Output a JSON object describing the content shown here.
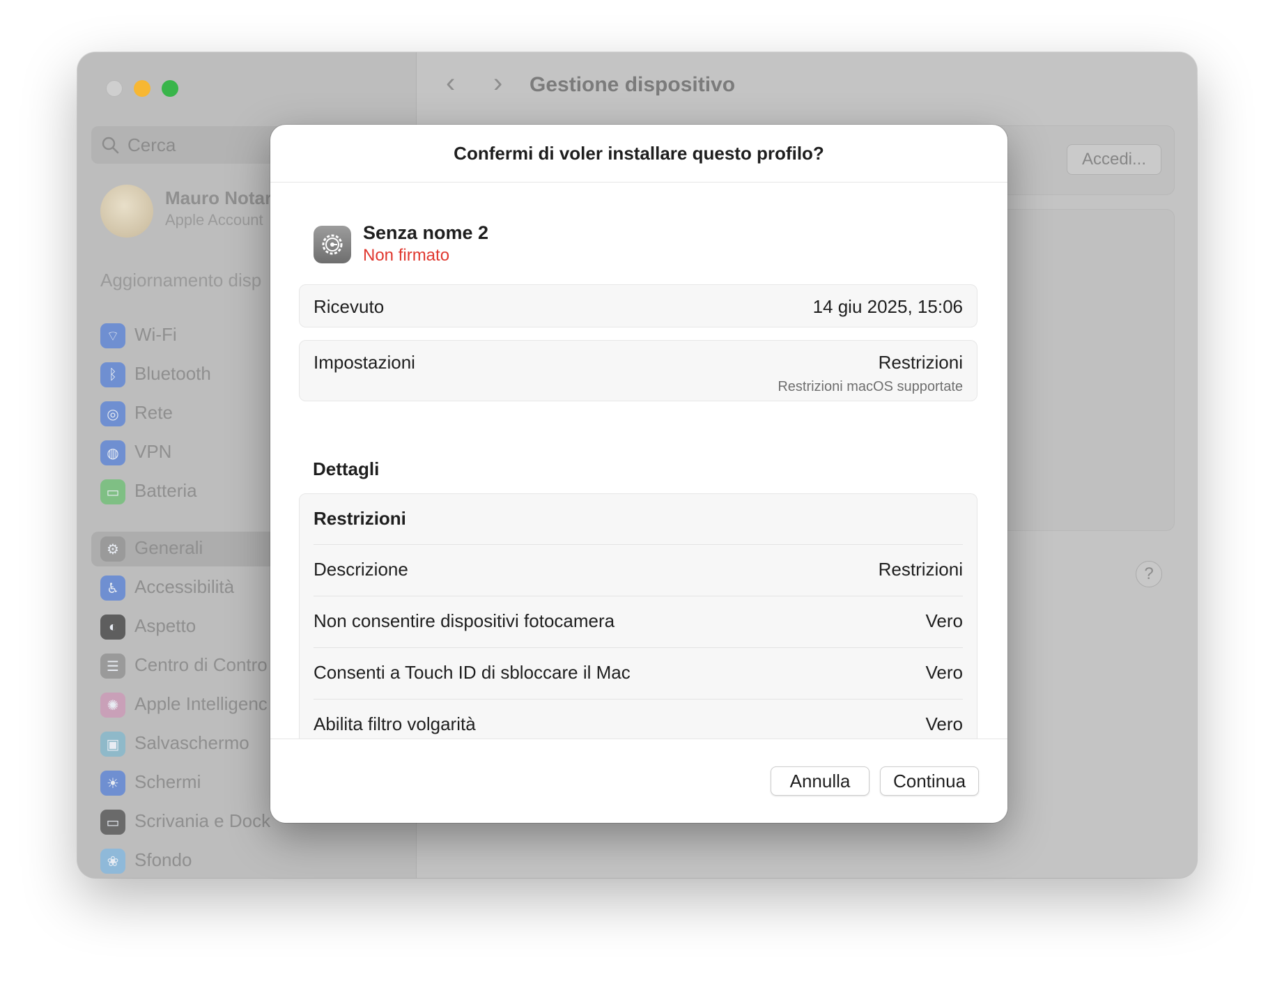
{
  "window": {
    "title": "Gestione dispositivo"
  },
  "sidebar": {
    "search_placeholder": "Cerca",
    "account": {
      "name": "Mauro Notar",
      "subtitle": "Apple Account"
    },
    "update_label": "Aggiornamento disp",
    "items": [
      {
        "label": "Wi-Fi",
        "icon": "wifi-icon",
        "color": "#6f8fd1",
        "glyph": "⌔"
      },
      {
        "label": "Bluetooth",
        "icon": "bluetooth-icon",
        "color": "#6f8fd1",
        "glyph": "ᛒ"
      },
      {
        "label": "Rete",
        "icon": "globe-icon",
        "color": "#6f8fd1",
        "glyph": "◎"
      },
      {
        "label": "VPN",
        "icon": "vpn-globe-icon",
        "color": "#6f8fd1",
        "glyph": "◍"
      },
      {
        "label": "Batteria",
        "icon": "battery-icon",
        "color": "#7fbf84",
        "glyph": "▭"
      },
      {
        "label": "Generali",
        "icon": "gear-icon",
        "color": "#9a9a9a",
        "glyph": "⚙"
      },
      {
        "label": "Accessibilità",
        "icon": "accessibility-icon",
        "color": "#6f8fd1",
        "glyph": "♿"
      },
      {
        "label": "Aspetto",
        "icon": "appearance-icon",
        "color": "#5e5e5e",
        "glyph": "◐"
      },
      {
        "label": "Centro di Contro",
        "icon": "control-center-icon",
        "color": "#9a9a9a",
        "glyph": "☰"
      },
      {
        "label": "Apple Intelligenc",
        "icon": "apple-intelligence-icon",
        "color": "#c9a0b8",
        "glyph": "✺"
      },
      {
        "label": "Salvaschermo",
        "icon": "screensaver-icon",
        "color": "#8fb9c9",
        "glyph": "▣"
      },
      {
        "label": "Schermi",
        "icon": "displays-icon",
        "color": "#6f8fd1",
        "glyph": "☀"
      },
      {
        "label": "Scrivania e Dock",
        "icon": "desktop-dock-icon",
        "color": "#6a6a6a",
        "glyph": "▭"
      },
      {
        "label": "Sfondo",
        "icon": "wallpaper-icon",
        "color": "#8fb9d9",
        "glyph": "❀"
      }
    ],
    "selected_index": 5
  },
  "content": {
    "signin_button": "Accedi...",
    "help_button": "?"
  },
  "dialog": {
    "title": "Confermi di voler installare questo profilo?",
    "profile": {
      "name": "Senza nome 2",
      "status": "Non firmato",
      "status_color": "#e0382f"
    },
    "received": {
      "label": "Ricevuto",
      "value": "14 giu 2025, 15:06"
    },
    "settings": {
      "label": "Impostazioni",
      "value": "Restrizioni",
      "sub": "Restrizioni macOS supportate"
    },
    "details_title": "Dettagli",
    "details_card": {
      "heading": "Restrizioni",
      "rows": [
        {
          "label": "Descrizione",
          "value": "Restrizioni"
        },
        {
          "label": "Non consentire dispositivi fotocamera",
          "value": "Vero"
        },
        {
          "label": "Consenti a Touch ID di sbloccare il Mac",
          "value": "Vero"
        },
        {
          "label": "Abilita filtro volgarità",
          "value": "Vero"
        }
      ]
    },
    "buttons": {
      "cancel": "Annulla",
      "continue": "Continua"
    }
  }
}
